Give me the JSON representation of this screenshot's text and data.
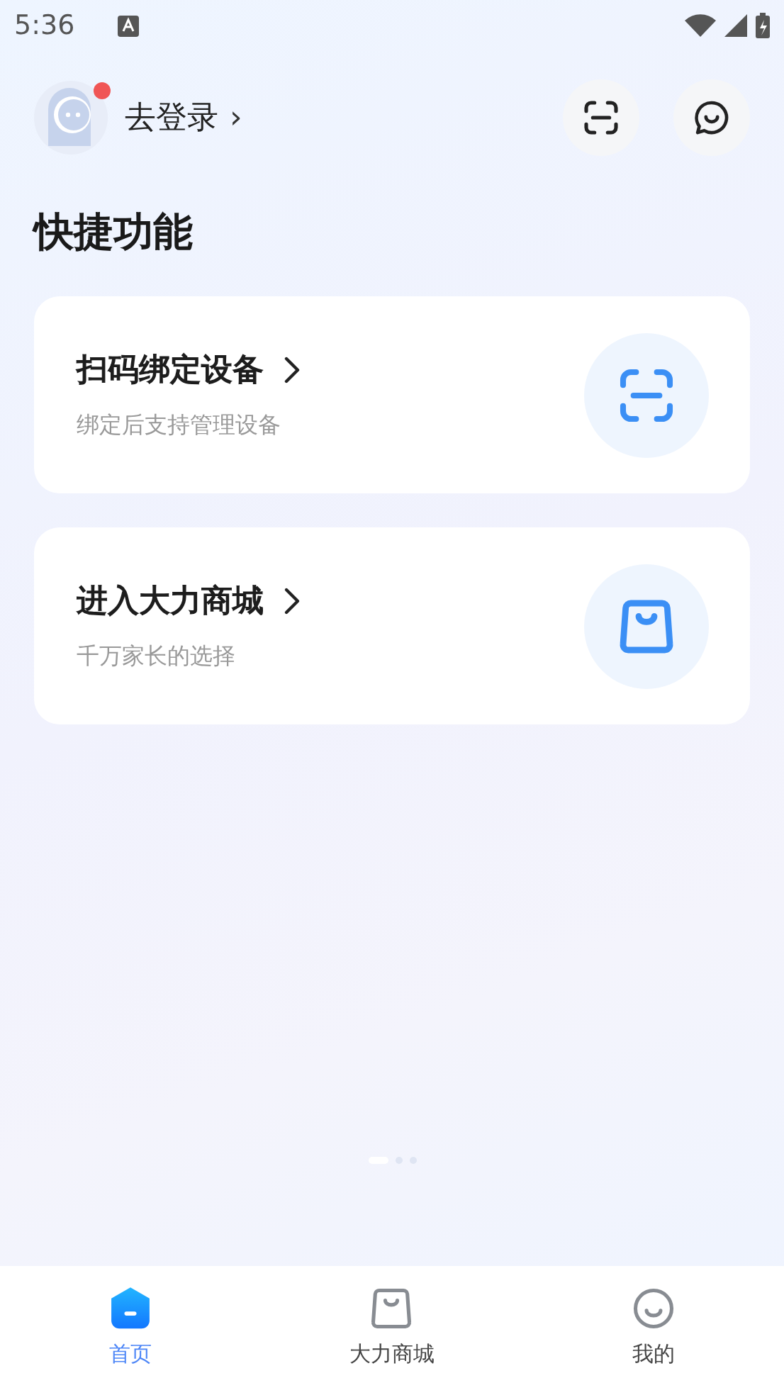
{
  "status_bar": {
    "time": "5:36"
  },
  "header": {
    "login_label": "去登录",
    "chevron": "›",
    "has_notification": true
  },
  "section_title": "快捷功能",
  "cards": [
    {
      "kind": "scan",
      "title": "扫码绑定设备",
      "subtitle": "绑定后支持管理设备"
    },
    {
      "kind": "shop",
      "title": "进入大力商城",
      "subtitle": "千万家长的选择"
    }
  ],
  "pager": [
    {
      "selected": true
    },
    {
      "selected": false
    },
    {
      "selected": false
    }
  ],
  "tabs": [
    {
      "kind": "home",
      "label": "首页",
      "selected": true
    },
    {
      "kind": "shop",
      "label": "大力商城",
      "selected": false
    },
    {
      "kind": "me",
      "label": "我的",
      "selected": false
    }
  ]
}
